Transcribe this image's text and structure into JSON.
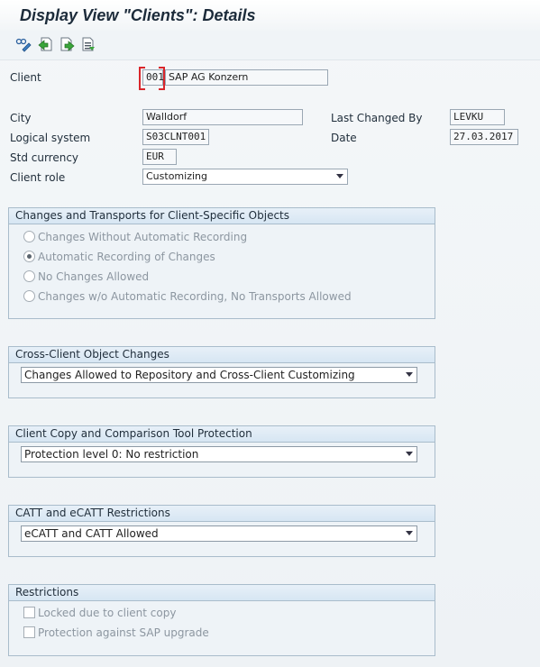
{
  "header": {
    "title": "Display View \"Clients\": Details"
  },
  "toolbar": {
    "buttons": [
      {
        "icon": "display-change-icon"
      },
      {
        "icon": "previous-entry-icon"
      },
      {
        "icon": "next-entry-icon"
      },
      {
        "icon": "variable-list-icon"
      }
    ]
  },
  "form": {
    "client_label": "Client",
    "client_value": "001",
    "client_name": "SAP AG Konzern",
    "city_label": "City",
    "city_value": "Walldorf",
    "last_changed_by_label": "Last Changed By",
    "last_changed_by_value": "LEVKU",
    "logical_system_label": "Logical system",
    "logical_system_value": "S03CLNT001",
    "date_label": "Date",
    "date_value": "27.03.2017",
    "std_currency_label": "Std currency",
    "std_currency_value": "EUR",
    "client_role_label": "Client role",
    "client_role_value": "Customizing"
  },
  "changes_transports": {
    "title": "Changes and Transports for Client-Specific Objects",
    "options": [
      {
        "label": "Changes Without Automatic Recording",
        "selected": false
      },
      {
        "label": "Automatic Recording of Changes",
        "selected": true
      },
      {
        "label": "No Changes Allowed",
        "selected": false
      },
      {
        "label": "Changes w/o Automatic Recording, No Transports Allowed",
        "selected": false
      }
    ]
  },
  "cross_client": {
    "title": "Cross-Client Object Changes",
    "value": "Changes Allowed to Repository and Cross-Client Customizing"
  },
  "copy_protection": {
    "title": "Client Copy and Comparison Tool Protection",
    "value": "Protection level 0: No restriction"
  },
  "catt": {
    "title": "CATT and eCATT Restrictions",
    "value": "eCATT and CATT Allowed"
  },
  "restrictions": {
    "title": "Restrictions",
    "options": [
      {
        "label": "Locked due to client copy",
        "checked": false
      },
      {
        "label": "Protection against SAP upgrade",
        "checked": false
      }
    ]
  },
  "colors": {
    "group_header": "#dce9f4",
    "group_border": "#a9bccb",
    "focus_bracket": "#d9262b"
  }
}
